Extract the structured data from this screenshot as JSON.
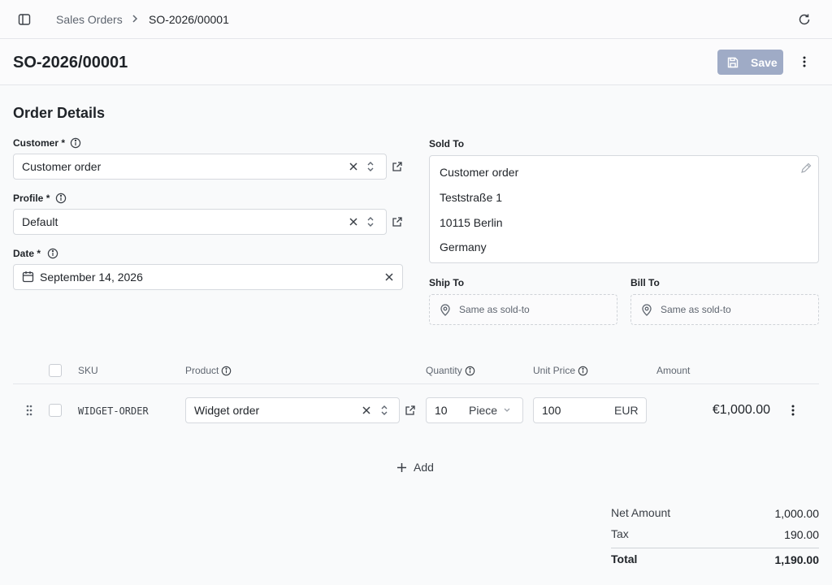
{
  "breadcrumb": {
    "parent": "Sales Orders",
    "current": "SO-2026/00001"
  },
  "page": {
    "title": "SO-2026/00001",
    "save_label": "Save"
  },
  "section": {
    "title": "Order Details"
  },
  "form": {
    "customer": {
      "label": "Customer",
      "required": "*",
      "value": "Customer order"
    },
    "profile": {
      "label": "Profile",
      "required": "*",
      "value": "Default"
    },
    "date": {
      "label": "Date",
      "required": "*",
      "value": "September 14, 2026"
    }
  },
  "sold_to": {
    "label": "Sold To",
    "lines": [
      "Customer order",
      "Teststraße 1",
      "10115 Berlin",
      "Germany"
    ]
  },
  "ship_to": {
    "label": "Ship To",
    "placeholder": "Same as sold-to"
  },
  "bill_to": {
    "label": "Bill To",
    "placeholder": "Same as sold-to"
  },
  "table": {
    "headers": {
      "sku": "SKU",
      "product": "Product",
      "quantity": "Quantity",
      "unit_price": "Unit Price",
      "amount": "Amount"
    },
    "rows": [
      {
        "sku": "WIDGET-ORDER",
        "product": "Widget order",
        "quantity": "10",
        "unit": "Piece",
        "unit_price": "100",
        "currency": "EUR",
        "amount": "€1,000.00"
      }
    ],
    "add_label": "Add"
  },
  "totals": {
    "net_label": "Net Amount",
    "net_value": "1,000.00",
    "tax_label": "Tax",
    "tax_value": "190.00",
    "total_label": "Total",
    "total_value": "1,190.00"
  },
  "colors": {
    "primary_disabled": "#9fabc6",
    "border": "#d6d9de",
    "muted_text": "#5f6670"
  },
  "icons": [
    "sidebar-toggle-icon",
    "chevron-right-icon",
    "refresh-icon",
    "save-icon",
    "more-vertical-icon",
    "info-icon",
    "clear-icon",
    "updown-icon",
    "external-link-icon",
    "calendar-icon",
    "pencil-icon",
    "map-pin-icon",
    "drag-handle-icon",
    "chevron-down-icon",
    "plus-icon"
  ]
}
